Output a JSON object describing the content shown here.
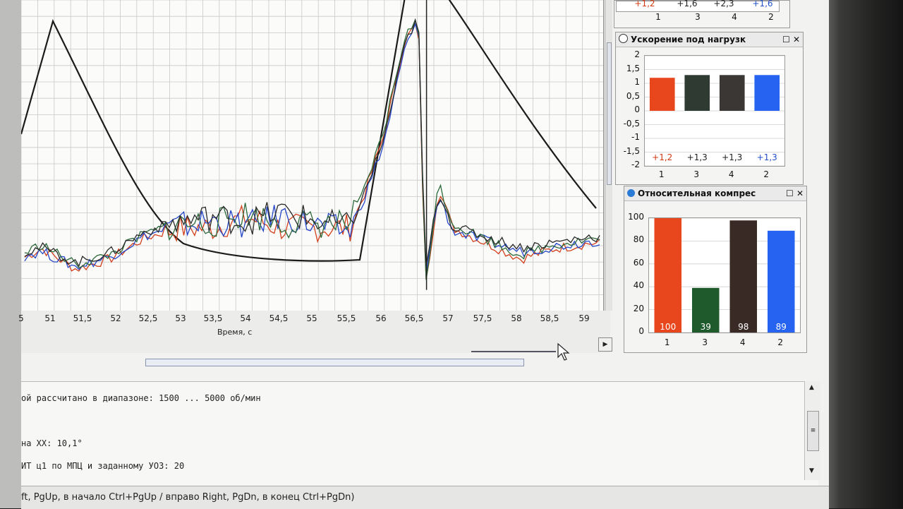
{
  "main_chart": {
    "xlabel": "Время, с",
    "x_ticks": [
      "5",
      "51",
      "51,5",
      "52",
      "52,5",
      "53",
      "53,5",
      "54",
      "54,5",
      "55",
      "55,5",
      "56",
      "56,5",
      "57",
      "57,5",
      "58",
      "58,5",
      "59"
    ]
  },
  "panel_top_partial": {
    "values": [
      "+1,2",
      "+1,6",
      "+2,3",
      "+1,6"
    ],
    "categories": [
      "1",
      "3",
      "4",
      "2"
    ]
  },
  "panel_accel": {
    "title": "Ускорение под нагрузк",
    "y_ticks": [
      "2",
      "1,5",
      "1",
      "0,5",
      "0",
      "-0,5",
      "-1",
      "-1,5",
      "-2"
    ],
    "categories": [
      "1",
      "3",
      "4",
      "2"
    ],
    "value_labels": [
      "+1,2",
      "+1,3",
      "+1,3",
      "+1,3"
    ]
  },
  "panel_compress": {
    "title": "Относительная компрес",
    "y_ticks": [
      "100",
      "80",
      "60",
      "40",
      "20",
      "0"
    ],
    "categories": [
      "1",
      "3",
      "4",
      "2"
    ],
    "value_labels": [
      "100",
      "39",
      "98",
      "89"
    ]
  },
  "chart_data": [
    {
      "type": "line",
      "xlabel": "Время, с",
      "ylabel": "",
      "title": "",
      "xlim": [
        50.7,
        59.2
      ],
      "series": [
        {
          "name": "",
          "x": [
            50.7,
            51.0,
            51.5,
            52.0,
            52.5,
            53.0,
            53.5,
            54.0,
            54.5,
            55.0,
            55.5,
            55.7,
            56.0,
            56.3,
            56.5,
            56.6,
            56.8,
            57.0,
            57.5,
            58.0,
            58.5,
            59.0
          ],
          "y": [
            0.3,
            0.4,
            0.2,
            0.3,
            0.5,
            0.6,
            0.6,
            0.7,
            0.6,
            0.6,
            0.6,
            0.9,
            1.5,
            2.4,
            2.6,
            0.0,
            1.0,
            0.6,
            0.45,
            0.3,
            0.4,
            0.45
          ]
        },
        {
          "name": "",
          "x": [
            50.7,
            51.0,
            51.5,
            52.0,
            52.5,
            53.0,
            53.5,
            54.0,
            54.5,
            55.0,
            55.5,
            55.7,
            56.0,
            56.3,
            56.5,
            56.6,
            56.8,
            57.0,
            57.5,
            58.0,
            58.5,
            59.0
          ],
          "y": [
            0.3,
            0.35,
            0.2,
            0.3,
            0.5,
            0.6,
            0.65,
            0.6,
            0.7,
            0.6,
            0.55,
            0.85,
            1.4,
            2.3,
            2.6,
            0.1,
            0.9,
            0.55,
            0.45,
            0.35,
            0.4,
            0.45
          ]
        }
      ]
    },
    {
      "type": "bar",
      "title": "Ускорение под нагрузк",
      "categories": [
        "1",
        "3",
        "4",
        "2"
      ],
      "values": [
        1.2,
        1.3,
        1.3,
        1.3
      ],
      "ylim": [
        -2,
        2
      ],
      "colors": [
        "#e8461c",
        "#2f3a33",
        "#3a3735",
        "#2563f0"
      ]
    },
    {
      "type": "bar",
      "title": "Относительная компрес",
      "categories": [
        "1",
        "3",
        "4",
        "2"
      ],
      "values": [
        100,
        39,
        98,
        89
      ],
      "ylim": [
        0,
        100
      ],
      "colors": [
        "#e8461c",
        "#1f5a2c",
        "#3a2a26",
        "#2563f0"
      ]
    }
  ],
  "console": {
    "line1": "ой рассчитано в диапазоне: 1500 ... 5000 об/мин",
    "line2": "на XX: 10,1°",
    "line3": "ИТ ц1 по МПЦ и заданному УОЗ: 20"
  },
  "statusbar": "ft, PgUp, в начало Ctrl+PgUp / вправо Right, PgDn, в конец Ctrl+PgDn)"
}
